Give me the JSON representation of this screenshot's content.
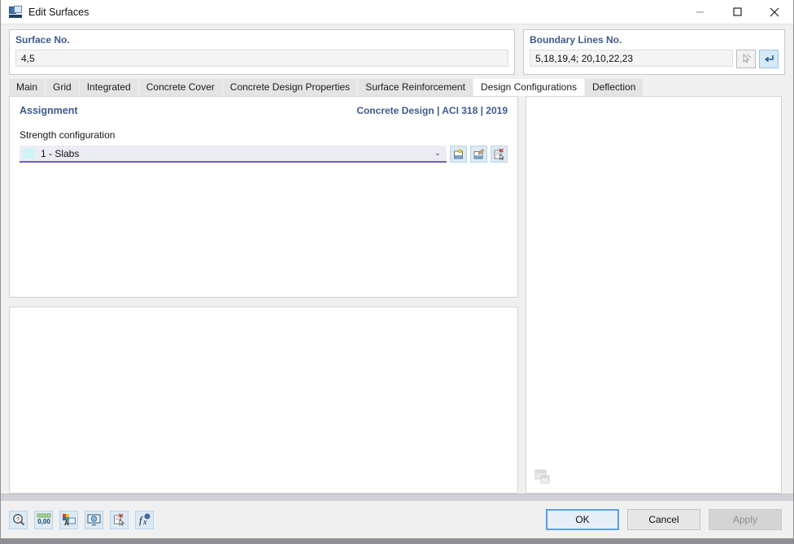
{
  "window": {
    "title": "Edit Surfaces",
    "icon": "app-surfaces-icon",
    "minimize_label": "—",
    "maximize_label": "□",
    "close_label": "✕"
  },
  "header": {
    "surface": {
      "label": "Surface No.",
      "value": "4,5"
    },
    "boundary": {
      "label": "Boundary Lines No.",
      "value": "5,18,19,4; 20,10,22,23",
      "pick_icon": "pick-cursor-icon",
      "apply_icon": "return-arrow-icon"
    }
  },
  "tabs": [
    {
      "label": "Main",
      "selected": false
    },
    {
      "label": "Grid",
      "selected": false
    },
    {
      "label": "Integrated",
      "selected": false
    },
    {
      "label": "Concrete Cover",
      "selected": false
    },
    {
      "label": "Concrete Design Properties",
      "selected": false
    },
    {
      "label": "Surface Reinforcement",
      "selected": false
    },
    {
      "label": "Design Configurations",
      "selected": true
    },
    {
      "label": "Deflection",
      "selected": false
    }
  ],
  "assignment": {
    "title": "Assignment",
    "code": "Concrete Design | ACI 318 | 2019",
    "strength_label": "Strength configuration",
    "combo_value": "1 - Slabs",
    "combo_swatch_color": "#ccf5f7",
    "caret": "⌄",
    "buttons": [
      {
        "name": "new-configuration-button"
      },
      {
        "name": "edit-configuration-button"
      },
      {
        "name": "delete-configuration-button"
      }
    ]
  },
  "right_panel": {
    "corner_icon": "cascade-windows-icon"
  },
  "footer": {
    "tools": [
      {
        "name": "help-info-icon"
      },
      {
        "name": "decimal-places-icon",
        "label": "0,00"
      },
      {
        "name": "units-and-colors-icon"
      },
      {
        "name": "view-display-icon"
      },
      {
        "name": "clear-selection-icon"
      },
      {
        "name": "formula-editor-icon"
      }
    ],
    "ok_label": "OK",
    "cancel_label": "Cancel",
    "apply_label": "Apply"
  },
  "colors": {
    "accent_blue": "#3f5a8a",
    "combo_underline": "#6a5fc0",
    "focus_border": "#5aa0dd"
  }
}
